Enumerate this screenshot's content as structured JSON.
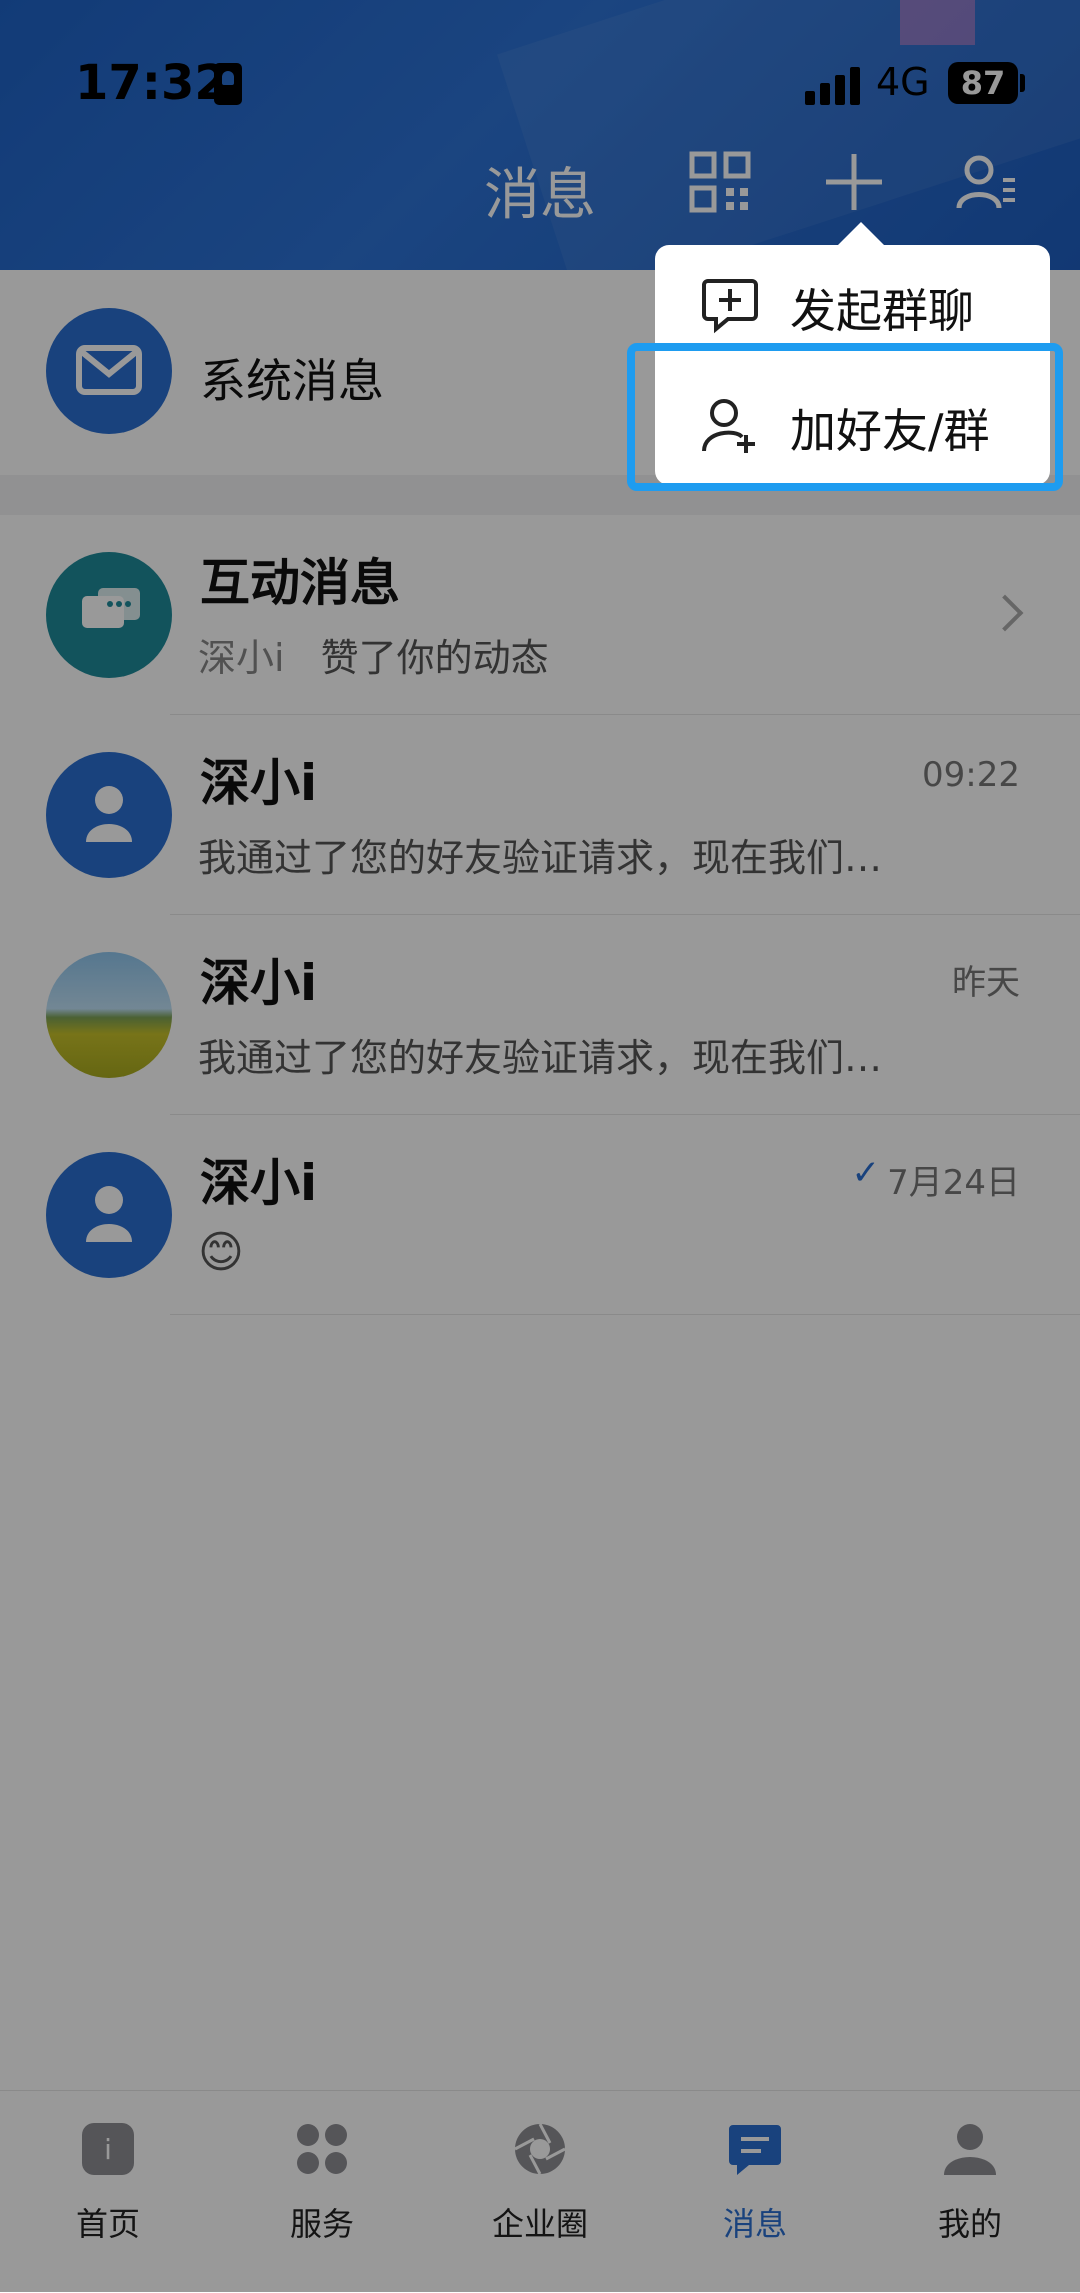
{
  "status_bar": {
    "time": "17:32",
    "network": "4G",
    "battery": "87"
  },
  "header": {
    "title": "消息"
  },
  "system_message": {
    "label": "系统消息"
  },
  "messages": [
    {
      "name": "互动消息",
      "preview_sender": "深小i",
      "preview_text": "赞了你的动态",
      "time": ""
    },
    {
      "name": "深小i",
      "preview_text": "我通过了您的好友验证请求，现在我们…",
      "time": "09:22"
    },
    {
      "name": "深小i",
      "preview_text": "我通过了您的好友验证请求，现在我们…",
      "time": "昨天"
    },
    {
      "name": "深小i",
      "preview_text": "😊",
      "time": "7月24日"
    }
  ],
  "popup_menu": {
    "items": [
      {
        "label": "发起群聊",
        "icon": "chat-plus-icon"
      },
      {
        "label": "加好友/群",
        "icon": "add-friend-icon"
      }
    ]
  },
  "bottom_nav": {
    "items": [
      {
        "label": "首页",
        "icon": "home-icon"
      },
      {
        "label": "服务",
        "icon": "grid-icon"
      },
      {
        "label": "企业圈",
        "icon": "aperture-icon"
      },
      {
        "label": "消息",
        "icon": "message-icon"
      },
      {
        "label": "我的",
        "icon": "person-icon"
      }
    ]
  },
  "colors": {
    "brand": "#2a6fd1",
    "highlight": "#1e9cf0"
  }
}
